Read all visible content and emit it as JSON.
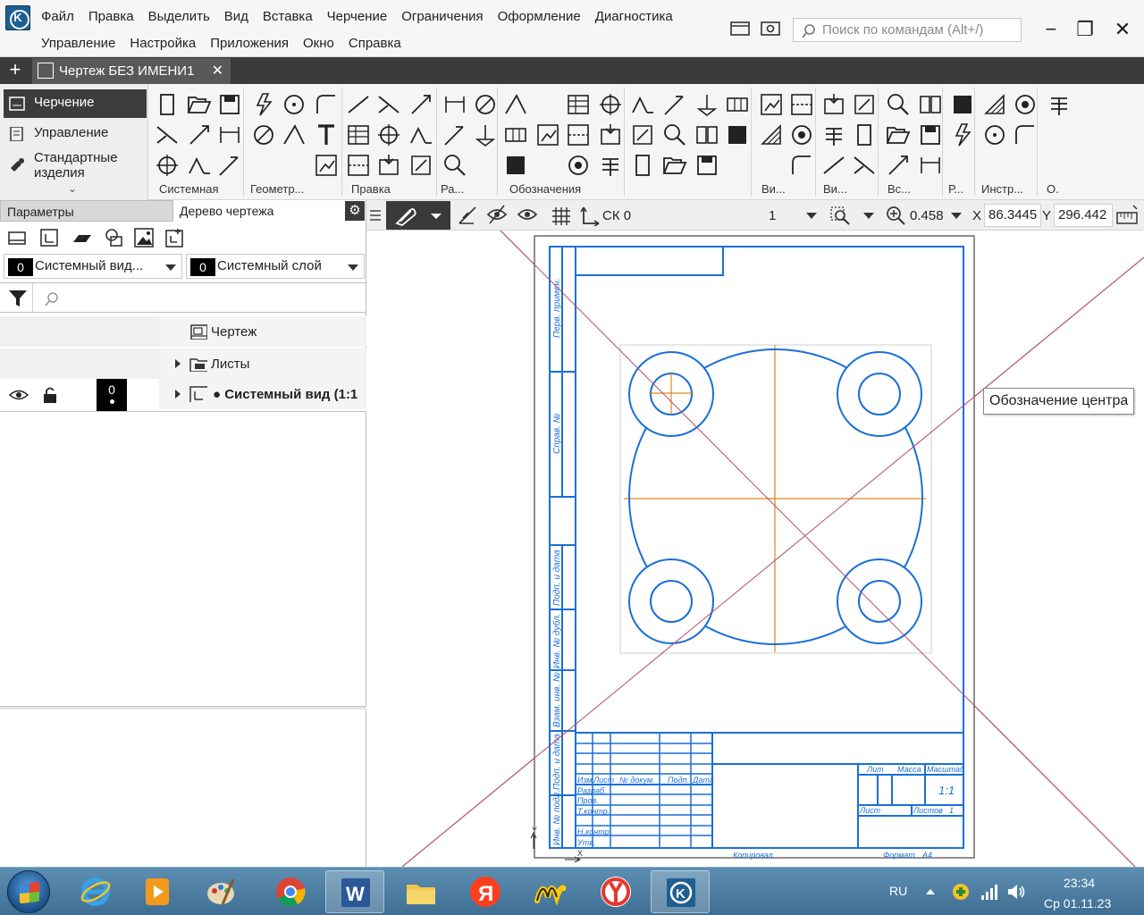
{
  "app": {
    "logo": "kompas-logo-icon",
    "menu_row1": [
      "Файл",
      "Правка",
      "Выделить",
      "Вид",
      "Вставка",
      "Черчение",
      "Ограничения",
      "Оформление",
      "Диагностика"
    ],
    "menu_row2": [
      "Управление",
      "Настройка",
      "Приложения",
      "Окно",
      "Справка"
    ],
    "search_placeholder": "Поиск по командам (Alt+/)",
    "window_controls": {
      "minimize": "−",
      "restore": "❐",
      "close": "✕"
    }
  },
  "doc_tabs": {
    "add": "+",
    "active_tab": "Чертеж БЕЗ ИМЕНИ1",
    "close": "✕"
  },
  "modes": [
    "Черчение",
    "Управление",
    "Стандартные изделия"
  ],
  "modes_expand": "⌄",
  "ribbon_groups": [
    "Системная",
    "Геометр...",
    "Правка",
    "Ра...",
    "Обозначения",
    "О...",
    "...",
    "Ви...",
    "Ви...",
    "Вс...",
    "Р...",
    "Инстр...",
    "О."
  ],
  "panel": {
    "tabs": [
      "Параметры",
      "Дерево чертежа"
    ],
    "settings_icon": "gear-icon",
    "view_select": {
      "num": "0",
      "value": "Системный вид..."
    },
    "layer_select": {
      "num": "0",
      "value": "Системный слой"
    },
    "search_placeholder": ""
  },
  "tree": {
    "rows": [
      {
        "label": "Чертеж",
        "icon": "drawing-icon"
      },
      {
        "label": "Листы",
        "icon": "sheets-icon"
      },
      {
        "label": "● Системный вид (1:1",
        "icon": "view-icon",
        "layer": "0"
      }
    ]
  },
  "canvas_toolbar": {
    "cs_label": "СК 0",
    "layer_label": "1",
    "zoom": "0.458",
    "x_label": "X",
    "x_value": "86.3445",
    "y_label": "Y",
    "y_value": "296.442"
  },
  "tooltip": "Обозначение центра",
  "title_block": {
    "lit": "Лит",
    "massa": "Масса",
    "masshtab": "Масштаб",
    "scale_val": "1:1",
    "list": "Лист",
    "listov": "Листов",
    "listov_val": "1",
    "izm": "Изм",
    "list2": "Лист",
    "ndokum": "№ докум.",
    "podp": "Подп.",
    "data": "Дата",
    "razrab": "Разраб.",
    "prov": "Пров.",
    "tkontr": "Т.контр.",
    "nkontr": "Н.контр.",
    "utv": "Утв.",
    "kopiroval": "Копировал",
    "format": "Формат",
    "format_val": "А4",
    "side_labels": [
      "Перв. примен.",
      "Справ. №",
      "Подп. и дата",
      "Инв. № дубл.",
      "Взам. инв. №",
      "Подп. и дата",
      "Инв. № подл."
    ],
    "axis_x": "X",
    "axis_y": "Y"
  },
  "colors": {
    "drawing_blue": "#1a6fd8",
    "axis_orange": "#d98a1c",
    "diagonal": "#b24a6e",
    "dark_ui": "#3a3a3a"
  },
  "taskbar": {
    "apps": [
      "internet-explorer-icon",
      "media-player-icon",
      "paint-icon",
      "chrome-icon",
      "word-icon",
      "explorer-icon",
      "yandex-icon",
      "yandex-music-icon",
      "yandex-browser-icon",
      "kompas-icon"
    ],
    "lang": "RU",
    "time": "23:34",
    "date": "Ср 01.11.23"
  }
}
